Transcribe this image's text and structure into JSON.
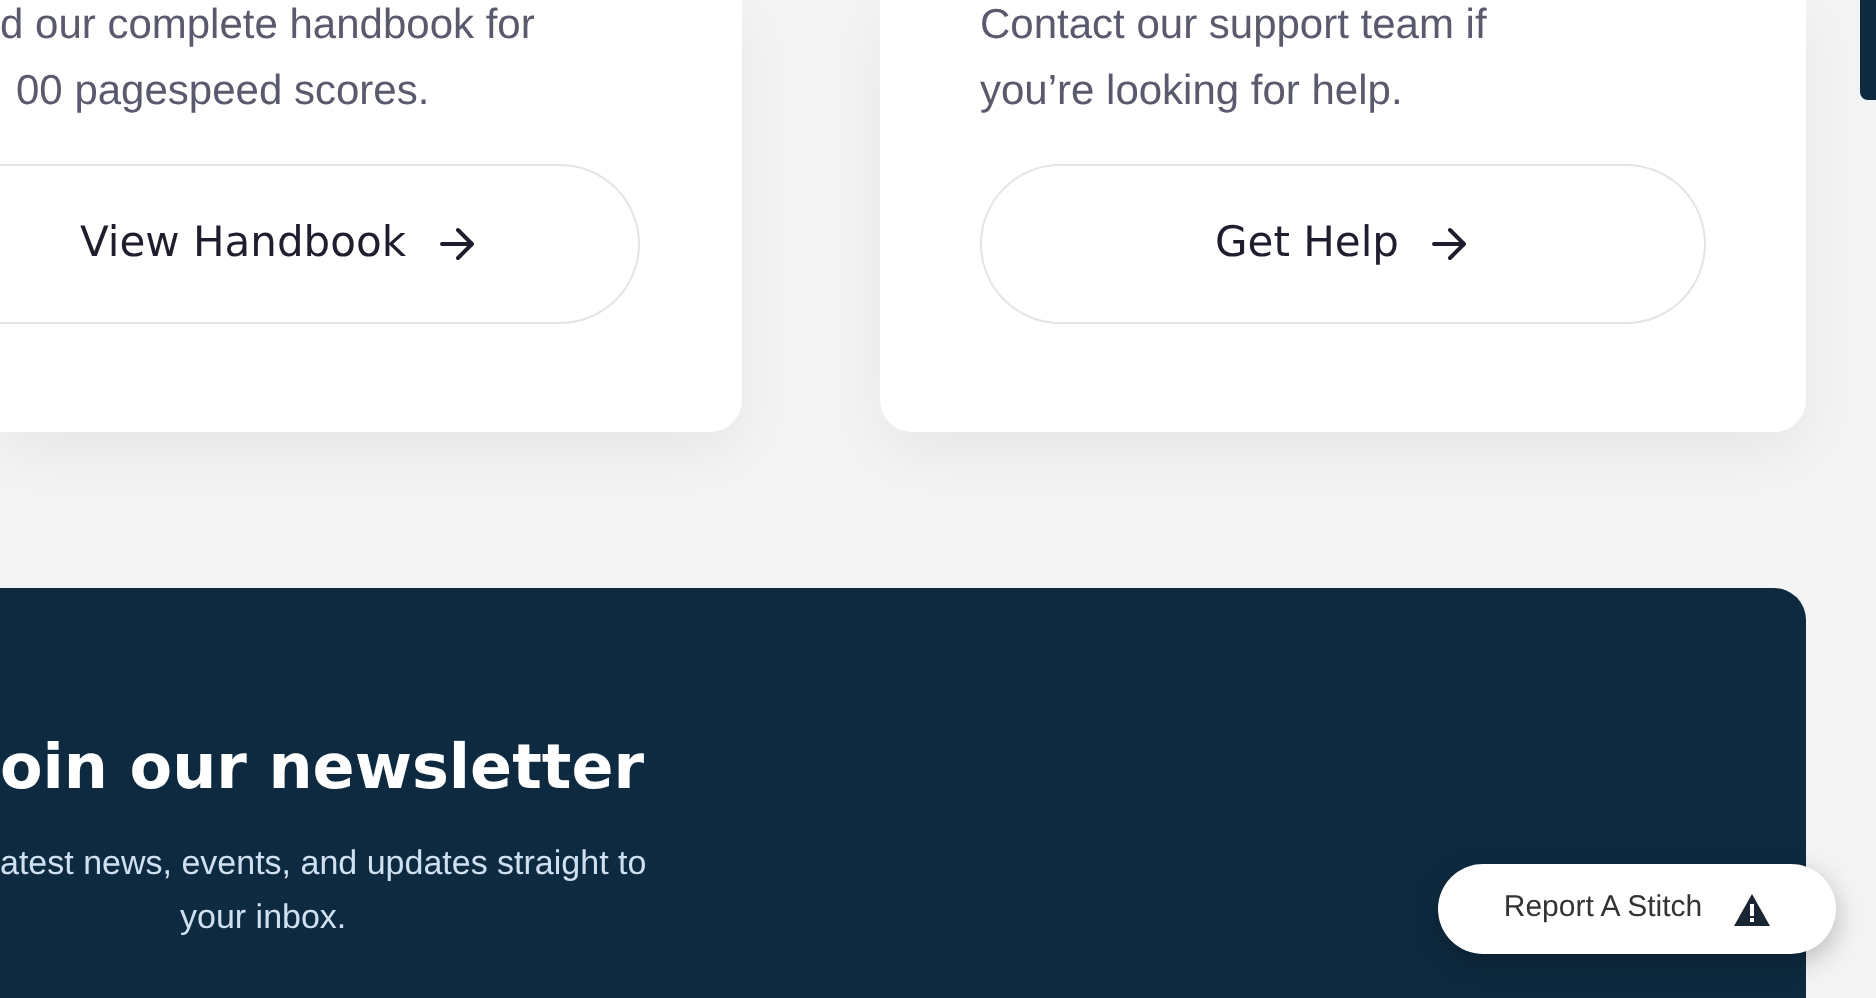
{
  "cards": [
    {
      "text_lines": [
        "d our complete handbook for",
        "00 pagespeed scores."
      ],
      "button": "View Handbook"
    },
    {
      "text_lines": [
        "Contact our support team if",
        "you’re looking for help."
      ],
      "button": "Get Help"
    }
  ],
  "newsletter": {
    "title": "oin our newsletter",
    "subtitle_lines": [
      "atest news, events, and updates straight to",
      "your inbox."
    ]
  },
  "report_button": "Report A Stitch"
}
